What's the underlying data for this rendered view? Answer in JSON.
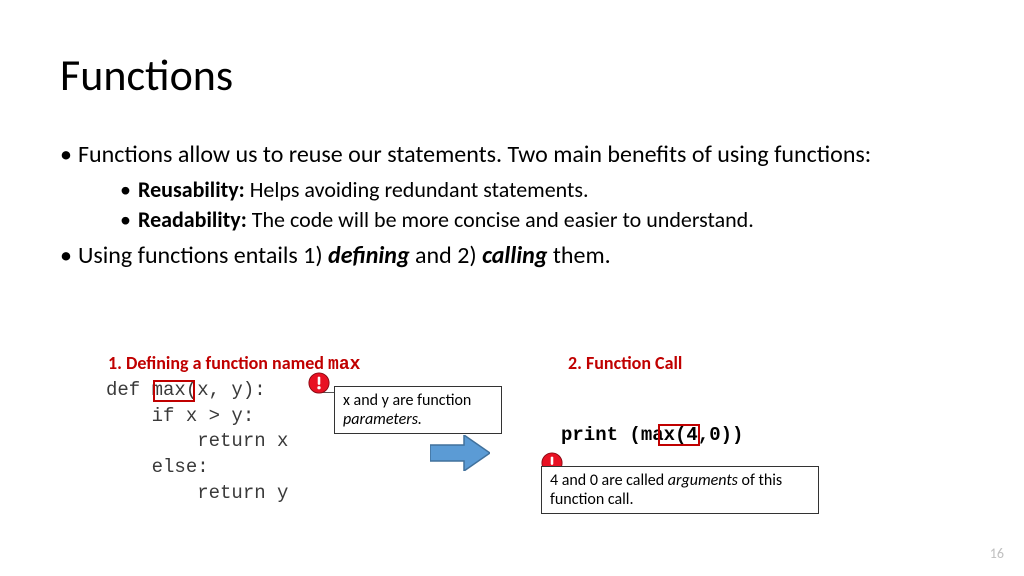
{
  "title": "Functions",
  "bullets": {
    "main1": "Functions allow us to reuse our statements. Two main benefits of using functions:",
    "sub1_label": "Reusability:",
    "sub1_text": " Helps avoiding redundant statements.",
    "sub2_label": "Readability:",
    "sub2_text": " The code will be more concise and easier to understand.",
    "main2_a": "Using functions entails 1) ",
    "main2_def": "defining",
    "main2_b": " and 2) ",
    "main2_call": "calling",
    "main2_c": " them."
  },
  "section1": {
    "label_a": "1. Defining a function named ",
    "label_mono": "max"
  },
  "section2": {
    "label": "2. Function Call"
  },
  "code_def": "def max(x, y):\n    if x > y:\n        return x\n    else:\n        return y",
  "params_note_a": "x and y are function ",
  "params_note_b": "parameters.",
  "call_code": "print (max(4,0))",
  "args_note_a": "4 and 0 are called ",
  "args_note_b": "arguments",
  "args_note_c": " of this function call.",
  "page_number": "16",
  "icons": {
    "warn": "exclaim-circle",
    "arrow": "right-arrow"
  },
  "colors": {
    "accent_red": "#c00000",
    "arrow_fill": "#5b9bd5",
    "arrow_stroke": "#41719c",
    "warn_fill": "#e81123"
  }
}
